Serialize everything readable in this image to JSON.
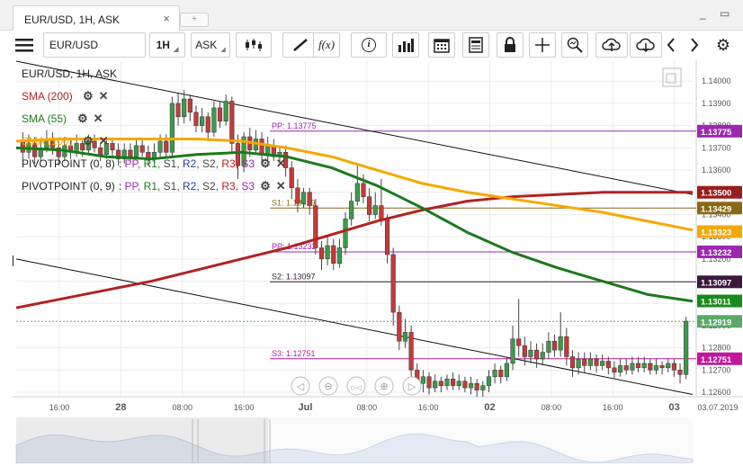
{
  "window": {
    "tab_title": "EUR/USD, 1H, ASK",
    "tab_close": "×",
    "tab_add": "+",
    "minimize": "_",
    "restore": "▭"
  },
  "toolbar": {
    "menu_icon": "hamburger-icon",
    "instrument": "EUR/USD",
    "period": "1H",
    "side": "ASK",
    "buttons": [
      "candles-icon",
      "draw-line-icon",
      "fx-indicator-icon",
      "info-icon",
      "volume-bars-icon",
      "calendar-icon",
      "data-table-icon",
      "lock-icon",
      "crosshair-icon",
      "zoom-icon",
      "upload-icon",
      "download-icon",
      "chevron-left-icon",
      "chevron-right-icon",
      "gear-icon"
    ],
    "fx_label": "f(x)",
    "info_label": "i"
  },
  "legend": {
    "title": "EUR/USD, 1H, ASK",
    "items": [
      {
        "label": "SMA (200)",
        "color": "#b22222"
      },
      {
        "label": "SMA (55)",
        "color": "#1a7a1a"
      },
      {
        "label": "SMA (100)",
        "color": "#f5a800"
      },
      {
        "label": "PIVOTPOINT (0, 8)",
        "params": [
          ": PP, ",
          "R1, ",
          "S1, ",
          "R2, ",
          "S2, ",
          "R3, ",
          "S3"
        ]
      },
      {
        "label": "PIVOTPOINT (0, 9)",
        "params": [
          ": PP, ",
          "R1, ",
          "S1, ",
          "R2, ",
          "S2, ",
          "R3, ",
          "S3"
        ]
      }
    ],
    "param_colors": [
      "#9c27b0",
      "#1a7a1a",
      "#444",
      "#1f3fa0",
      "#444",
      "#b22222",
      "#9c27b0"
    ]
  },
  "chart_data": {
    "type": "candlestick",
    "symbol": "EUR/USD",
    "timeframe": "1H",
    "price_side": "ASK",
    "ylim": [
      1.1258,
      1.1409
    ],
    "y_ticks": [
      "1.14000",
      "1.13900",
      "1.13800",
      "1.13700",
      "1.13600",
      "1.13500",
      "1.13400",
      "1.13300",
      "1.13200",
      "1.13100",
      "1.13000",
      "1.12900",
      "1.12800",
      "1.12700",
      "1.12600"
    ],
    "x_tick_labels": [
      "16:00",
      "28",
      "08:00",
      "16:00",
      "Jul",
      "08:00",
      "16:00",
      "02",
      "08:00",
      "16:00",
      "03",
      "03.07.2019"
    ],
    "pivot_levels": [
      {
        "label": "PP: 1.13775",
        "value": 1.13775,
        "badge": "1.13775",
        "color": "#9c27b0"
      },
      {
        "label": "S1: 1.13429",
        "value": 1.13429,
        "badge": "1.13429",
        "color": "#8b6914"
      },
      {
        "label": "PP: 1.13232",
        "value": 1.13232,
        "badge": "1.13232",
        "color": "#9c27b0"
      },
      {
        "label": "S2: 1.13097",
        "value": 1.13097,
        "badge": "1.13097",
        "color": "#3a1a3a"
      },
      {
        "label": "S3: 1.12751",
        "value": 1.12751,
        "badge": "1.12751",
        "color": "#c2189a"
      }
    ],
    "price_badges": [
      {
        "value": 1.135,
        "text": "1.13500",
        "color": "#9b1c1c"
      },
      {
        "value": 1.13323,
        "text": "1.13323",
        "color": "#f5a800"
      },
      {
        "value": 1.13011,
        "text": "1.13011",
        "color": "#1a8a1a"
      },
      {
        "value": 1.12919,
        "text": "1.12919",
        "color": "#5aa86a"
      }
    ],
    "current_price": 1.12919,
    "sma200": [
      1.1298,
      1.1302,
      1.1306,
      1.131,
      1.1315,
      1.132,
      1.1325,
      1.1331,
      1.1337,
      1.1342,
      1.1346,
      1.1348,
      1.1349,
      1.135,
      1.135,
      1.135
    ],
    "sma100": [
      1.1373,
      1.1374,
      1.1374,
      1.1374,
      1.1374,
      1.1373,
      1.137,
      1.1366,
      1.136,
      1.1354,
      1.135,
      1.1347,
      1.1344,
      1.1341,
      1.1337,
      1.1333
    ],
    "sma55": [
      1.137,
      1.1369,
      1.1366,
      1.1365,
      1.1367,
      1.1368,
      1.1366,
      1.1361,
      1.1353,
      1.1343,
      1.1332,
      1.1323,
      1.1316,
      1.131,
      1.1304,
      1.1301
    ],
    "candles": [
      [
        1.1373,
        1.1368,
        1.1377,
        1.1364
      ],
      [
        1.1368,
        1.1372,
        1.1376,
        1.1365
      ],
      [
        1.1372,
        1.1366,
        1.1375,
        1.1363
      ],
      [
        1.1366,
        1.137,
        1.1374,
        1.1364
      ],
      [
        1.137,
        1.1374,
        1.1378,
        1.1368
      ],
      [
        1.1374,
        1.137,
        1.1377,
        1.1367
      ],
      [
        1.137,
        1.1366,
        1.1373,
        1.1362
      ],
      [
        1.1366,
        1.1371,
        1.1375,
        1.1364
      ],
      [
        1.1371,
        1.1368,
        1.1374,
        1.1365
      ],
      [
        1.1368,
        1.1372,
        1.1376,
        1.1366
      ],
      [
        1.1372,
        1.1369,
        1.1374,
        1.1366
      ],
      [
        1.1369,
        1.1373,
        1.1376,
        1.1367
      ],
      [
        1.1373,
        1.137,
        1.1376,
        1.1368
      ],
      [
        1.137,
        1.1367,
        1.1372,
        1.1364
      ],
      [
        1.1367,
        1.1372,
        1.1375,
        1.1365
      ],
      [
        1.1372,
        1.1369,
        1.1374,
        1.1366
      ],
      [
        1.1369,
        1.1365,
        1.1372,
        1.1362
      ],
      [
        1.1365,
        1.1369,
        1.1372,
        1.1363
      ],
      [
        1.1369,
        1.1366,
        1.1372,
        1.1364
      ],
      [
        1.1366,
        1.1371,
        1.1374,
        1.1365
      ],
      [
        1.1371,
        1.1368,
        1.1374,
        1.1366
      ],
      [
        1.1368,
        1.1365,
        1.1371,
        1.1362
      ],
      [
        1.1365,
        1.1368,
        1.1372,
        1.1363
      ],
      [
        1.1368,
        1.1373,
        1.1376,
        1.1366
      ],
      [
        1.1373,
        1.1368,
        1.1376,
        1.1366
      ],
      [
        1.1368,
        1.139,
        1.1393,
        1.1366
      ],
      [
        1.139,
        1.1384,
        1.1395,
        1.138
      ],
      [
        1.1384,
        1.1392,
        1.1396,
        1.1381
      ],
      [
        1.1392,
        1.1386,
        1.1394,
        1.1382
      ],
      [
        1.1386,
        1.138,
        1.1389,
        1.1377
      ],
      [
        1.138,
        1.1384,
        1.1388,
        1.1377
      ],
      [
        1.1384,
        1.1377,
        1.1386,
        1.1373
      ],
      [
        1.1377,
        1.1388,
        1.1391,
        1.1375
      ],
      [
        1.1388,
        1.1382,
        1.1391,
        1.1379
      ],
      [
        1.1382,
        1.1391,
        1.1394,
        1.138
      ],
      [
        1.1391,
        1.1372,
        1.1393,
        1.1368
      ],
      [
        1.1372,
        1.1362,
        1.1376,
        1.1356
      ],
      [
        1.1362,
        1.1375,
        1.1377,
        1.1359
      ],
      [
        1.1375,
        1.1369,
        1.1379,
        1.1366
      ],
      [
        1.1369,
        1.1374,
        1.1378,
        1.1367
      ],
      [
        1.1374,
        1.1367,
        1.1377,
        1.1363
      ],
      [
        1.1367,
        1.1371,
        1.1375,
        1.1364
      ],
      [
        1.1371,
        1.1366,
        1.1374,
        1.1364
      ],
      [
        1.1366,
        1.1368,
        1.1371,
        1.1363
      ],
      [
        1.1368,
        1.1361,
        1.1371,
        1.1357
      ],
      [
        1.1361,
        1.1352,
        1.1364,
        1.1347
      ],
      [
        1.1352,
        1.1345,
        1.1356,
        1.1341
      ],
      [
        1.1345,
        1.135,
        1.1352,
        1.1343
      ],
      [
        1.135,
        1.1344,
        1.1352,
        1.134
      ],
      [
        1.1344,
        1.1325,
        1.1347,
        1.1322
      ],
      [
        1.1325,
        1.132,
        1.1328,
        1.1315
      ],
      [
        1.132,
        1.1326,
        1.133,
        1.1317
      ],
      [
        1.1326,
        1.1318,
        1.1329,
        1.1315
      ],
      [
        1.1318,
        1.1325,
        1.1329,
        1.1316
      ],
      [
        1.1325,
        1.1338,
        1.1341,
        1.1322
      ],
      [
        1.1338,
        1.1346,
        1.135,
        1.1335
      ],
      [
        1.1346,
        1.1354,
        1.1362,
        1.1344
      ],
      [
        1.1354,
        1.1348,
        1.1358,
        1.1345
      ],
      [
        1.1348,
        1.134,
        1.1352,
        1.1337
      ],
      [
        1.134,
        1.1344,
        1.135,
        1.1338
      ],
      [
        1.1344,
        1.1338,
        1.1356,
        1.1335
      ],
      [
        1.1338,
        1.1322,
        1.134,
        1.1318
      ],
      [
        1.1322,
        1.1296,
        1.1325,
        1.129
      ],
      [
        1.1296,
        1.1283,
        1.1299,
        1.1279
      ],
      [
        1.1283,
        1.1287,
        1.1293,
        1.128
      ],
      [
        1.1287,
        1.127,
        1.129,
        1.1266
      ],
      [
        1.127,
        1.1264,
        1.1273,
        1.126
      ],
      [
        1.1264,
        1.1267,
        1.127,
        1.126
      ],
      [
        1.1267,
        1.1262,
        1.1269,
        1.1259
      ],
      [
        1.1262,
        1.1265,
        1.1268,
        1.126
      ],
      [
        1.1265,
        1.1263,
        1.1267,
        1.126
      ],
      [
        1.1263,
        1.1266,
        1.1268,
        1.1261
      ],
      [
        1.1266,
        1.1263,
        1.1269,
        1.1261
      ],
      [
        1.1263,
        1.1265,
        1.1268,
        1.1261
      ],
      [
        1.1265,
        1.1262,
        1.1267,
        1.126
      ],
      [
        1.1262,
        1.1264,
        1.1267,
        1.1259
      ],
      [
        1.1264,
        1.1261,
        1.1266,
        1.1258
      ],
      [
        1.1261,
        1.1263,
        1.1265,
        1.1258
      ],
      [
        1.1263,
        1.1267,
        1.127,
        1.126
      ],
      [
        1.1267,
        1.127,
        1.1273,
        1.1264
      ],
      [
        1.127,
        1.1267,
        1.1272,
        1.1264
      ],
      [
        1.1267,
        1.1273,
        1.1276,
        1.1265
      ],
      [
        1.1273,
        1.1284,
        1.129,
        1.127
      ],
      [
        1.1284,
        1.1281,
        1.1302,
        1.1276
      ],
      [
        1.1281,
        1.1276,
        1.1285,
        1.1272
      ],
      [
        1.1276,
        1.1279,
        1.1283,
        1.1273
      ],
      [
        1.1279,
        1.1275,
        1.1282,
        1.1271
      ],
      [
        1.1275,
        1.1278,
        1.1282,
        1.1272
      ],
      [
        1.1278,
        1.1283,
        1.1287,
        1.1275
      ],
      [
        1.1283,
        1.1279,
        1.1286,
        1.1276
      ],
      [
        1.1279,
        1.1285,
        1.1296,
        1.1276
      ],
      [
        1.1285,
        1.1276,
        1.1289,
        1.1272
      ],
      [
        1.1276,
        1.1271,
        1.1279,
        1.1267
      ],
      [
        1.1271,
        1.1275,
        1.1278,
        1.1268
      ],
      [
        1.1275,
        1.1272,
        1.1278,
        1.1269
      ],
      [
        1.1272,
        1.1275,
        1.1278,
        1.127
      ],
      [
        1.1275,
        1.1272,
        1.1277,
        1.1269
      ],
      [
        1.1272,
        1.1274,
        1.1277,
        1.127
      ],
      [
        1.1274,
        1.1271,
        1.1276,
        1.1268
      ],
      [
        1.1271,
        1.1269,
        1.1274,
        1.1266
      ],
      [
        1.1269,
        1.1272,
        1.1275,
        1.1267
      ],
      [
        1.1272,
        1.127,
        1.1275,
        1.1268
      ],
      [
        1.127,
        1.1273,
        1.1276,
        1.1268
      ],
      [
        1.1273,
        1.1271,
        1.1276,
        1.1269
      ],
      [
        1.1271,
        1.1273,
        1.1276,
        1.1269
      ],
      [
        1.1273,
        1.127,
        1.1275,
        1.1268
      ],
      [
        1.127,
        1.1272,
        1.1275,
        1.1268
      ],
      [
        1.1272,
        1.1271,
        1.1274,
        1.1268
      ],
      [
        1.1271,
        1.1273,
        1.1275,
        1.1269
      ],
      [
        1.1273,
        1.127,
        1.1275,
        1.1267
      ],
      [
        1.127,
        1.1268,
        1.1273,
        1.1264
      ],
      [
        1.1268,
        1.1292,
        1.1294,
        1.1266
      ]
    ],
    "trendlines": [
      {
        "from": [
          0,
          1.1409
        ],
        "to": [
          1,
          1.1349
        ]
      },
      {
        "from": [
          0,
          1.132
        ],
        "to": [
          1,
          1.1259
        ]
      }
    ]
  },
  "nav_controls": [
    "nav-left-icon",
    "zoom-out-icon",
    "fit-icon",
    "zoom-in-icon",
    "nav-right-icon"
  ],
  "export_icon": "export-icon"
}
